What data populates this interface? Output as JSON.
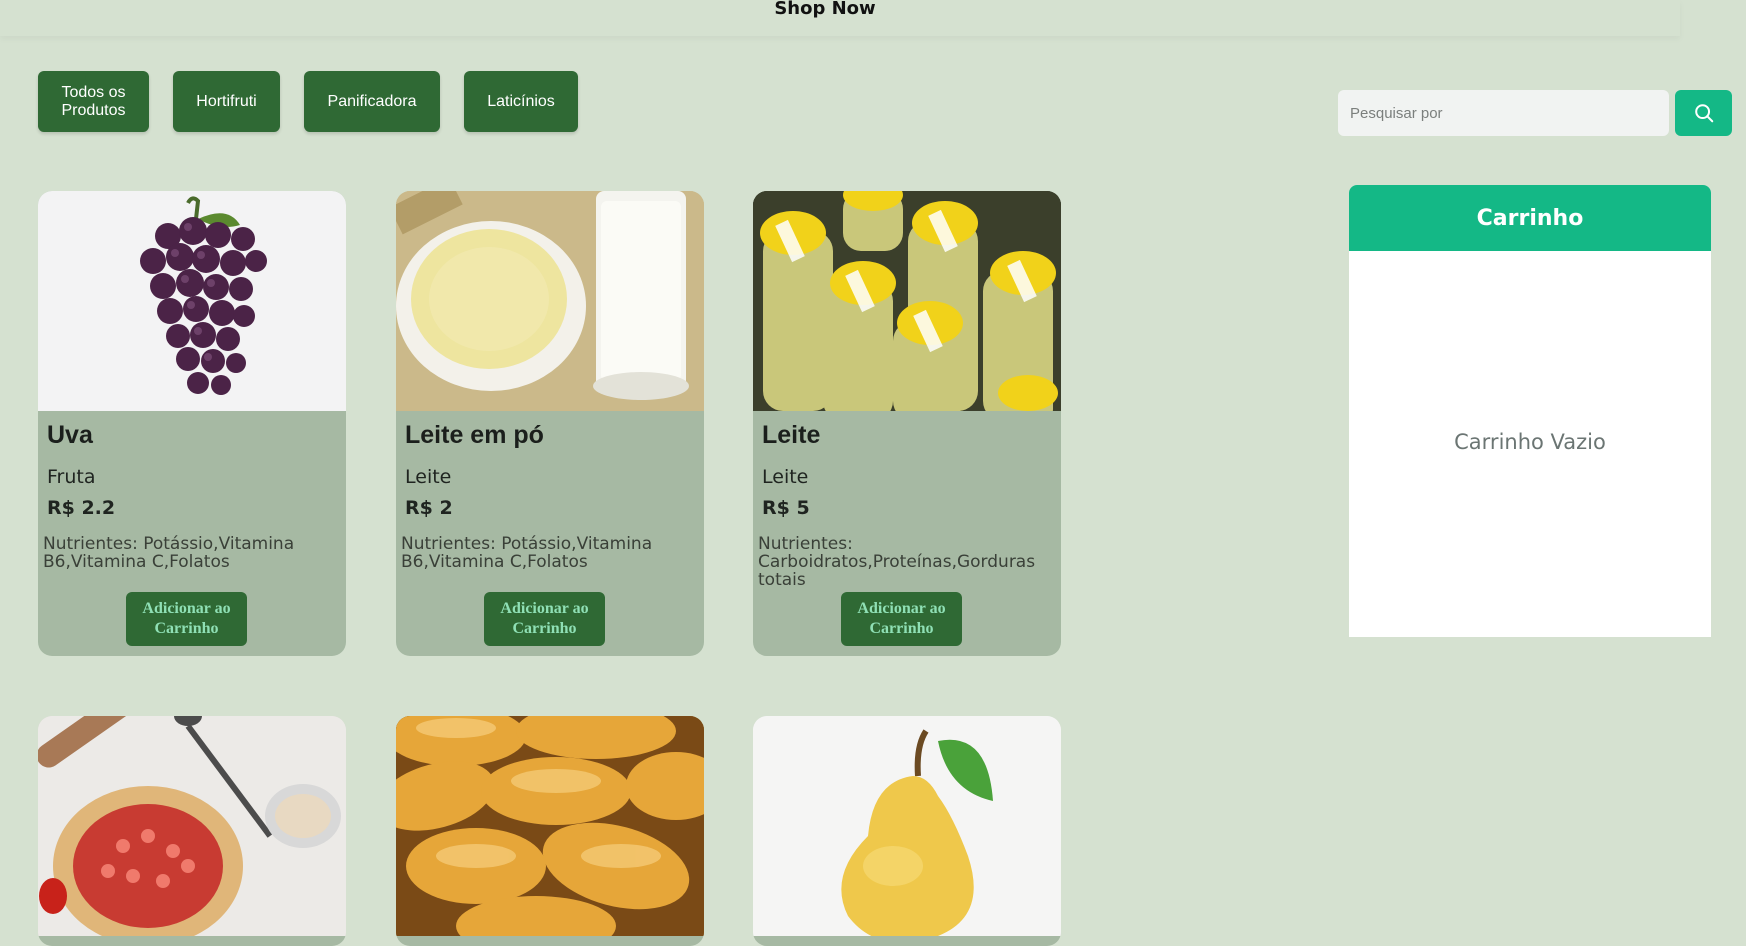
{
  "header": {
    "brand": "Shop Now"
  },
  "categories": [
    {
      "label": "Todos os Produtos"
    },
    {
      "label": "Hortifruti"
    },
    {
      "label": "Panificadora"
    },
    {
      "label": "Laticínios"
    }
  ],
  "search": {
    "placeholder": "Pesquisar por",
    "value": "",
    "icon": "search-icon"
  },
  "products": [
    {
      "name": "Uva",
      "type": "Fruta",
      "price": "R$ 2.2",
      "nutrients": "Nutrientes: Potássio,Vitamina B6,Vitamina C,Folatos",
      "button": "Adicionar ao Carrinho",
      "image": "grapes"
    },
    {
      "name": "Leite em pó",
      "type": "Leite",
      "price": "R$ 2",
      "nutrients": "Nutrientes: Potássio,Vitamina B6,Vitamina C,Folatos",
      "button": "Adicionar ao Carrinho",
      "image": "powdered-milk"
    },
    {
      "name": "Leite",
      "type": "Leite",
      "price": "R$ 5",
      "nutrients": "Nutrientes: Carboidratos,Proteínas,Gorduras totais",
      "button": "Adicionar ao Carrinho",
      "image": "milk-bottles"
    },
    {
      "image": "strawberry-pie"
    },
    {
      "image": "bread-rolls"
    },
    {
      "image": "pear"
    }
  ],
  "cart": {
    "title": "Carrinho",
    "empty_message": "Carrinho Vazio"
  },
  "colors": {
    "background": "#d5e1d0",
    "button_dark_green": "#2f6934",
    "accent_teal": "#14b886",
    "card_bg": "#a6b9a3"
  }
}
